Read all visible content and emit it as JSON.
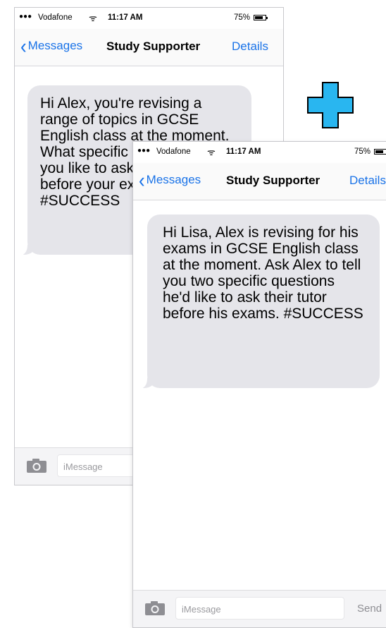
{
  "phone_back": {
    "status": {
      "signal": "●●●",
      "carrier": "Vodafone",
      "wifi_icon": "wifi-icon",
      "time": "11:17 AM",
      "battery": "75%"
    },
    "nav": {
      "back_label": "Messages",
      "title": "Study Supporter",
      "details": "Details"
    },
    "message": "Hi Alex, you're revising a range of topics in GCSE English class at the moment. What specific questions would you like to ask your tutor before your exams? #SUCCESS",
    "input_placeholder": "iMessage"
  },
  "phone_front": {
    "status": {
      "signal": "●●●",
      "carrier": "Vodafone",
      "wifi_icon": "wifi-icon",
      "time": "11:17 AM",
      "battery": "75%"
    },
    "nav": {
      "back_label": "Messages",
      "title": "Study Supporter",
      "details": "Details"
    },
    "message": "Hi Lisa, Alex is revising for his exams in GCSE English class at the moment. Ask Alex to tell you two specific questions he'd like to ask their tutor before his exams. #SUCCESS",
    "input_placeholder": "iMessage",
    "send_label": "Send"
  },
  "colors": {
    "accent": "#1a73e8",
    "bubble": "#e5e5ea",
    "plus_fill": "#29b6f0"
  }
}
